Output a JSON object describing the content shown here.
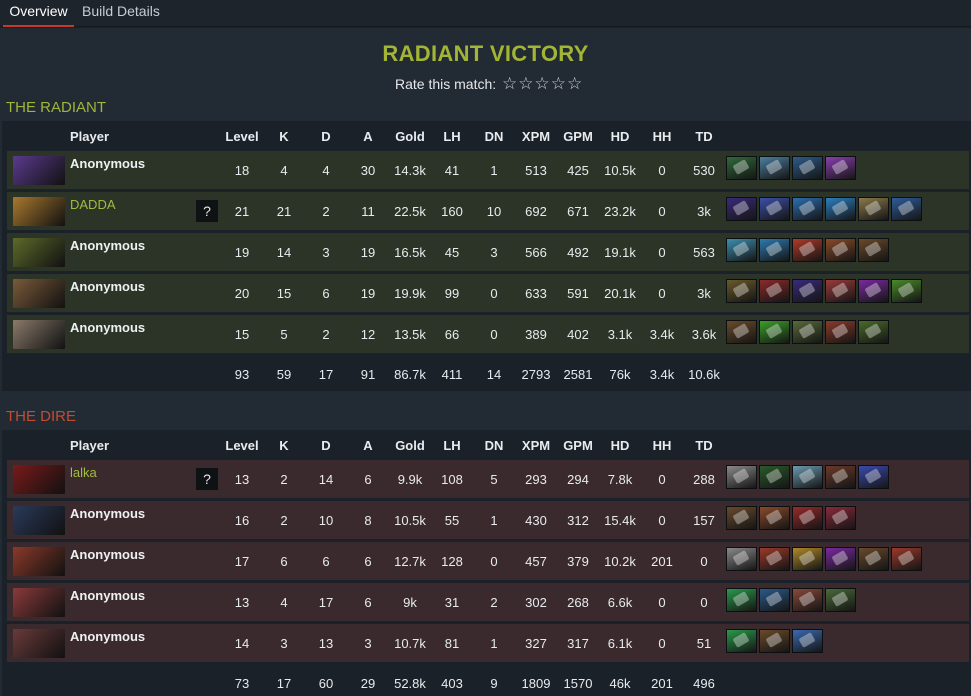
{
  "tabs": [
    "Overview",
    "Build Details"
  ],
  "title": "RADIANT VICTORY",
  "rate_label": "Rate this match:",
  "stars": [
    "☆",
    "☆",
    "☆",
    "☆",
    "☆"
  ],
  "columns": [
    "Player",
    "Level",
    "K",
    "D",
    "A",
    "Gold",
    "LH",
    "DN",
    "XPM",
    "GPM",
    "HD",
    "HH",
    "TD"
  ],
  "radiant": {
    "label": "THE RADIANT",
    "players": [
      {
        "name": "Anonymous",
        "named": false,
        "question": "",
        "stats": [
          "18",
          "4",
          "4",
          "30",
          "14.3k",
          "41",
          "1",
          "513",
          "425",
          "10.5k",
          "0",
          "530"
        ],
        "hero_color": "#5b3a8e",
        "items": [
          "#2f6b3a",
          "#4b7fa0",
          "#2d5c8a",
          "#8a3fb0"
        ]
      },
      {
        "name": "DADDA",
        "named": true,
        "question": "?",
        "stats": [
          "21",
          "21",
          "2",
          "11",
          "22.5k",
          "160",
          "10",
          "692",
          "671",
          "23.2k",
          "0",
          "3k"
        ],
        "hero_color": "#a9792e",
        "items": [
          "#3a2a7a",
          "#3b4fa8",
          "#2c6fb0",
          "#2b7fc0",
          "#8c7a4a",
          "#2f5c9a"
        ]
      },
      {
        "name": "Anonymous",
        "named": false,
        "question": "",
        "stats": [
          "19",
          "14",
          "3",
          "19",
          "16.5k",
          "45",
          "3",
          "566",
          "492",
          "19.1k",
          "0",
          "563"
        ],
        "hero_color": "#5c6a2a",
        "items": [
          "#3d8fb0",
          "#2e7ab0",
          "#b03a2a",
          "#8a4a2a",
          "#6a4a2a"
        ]
      },
      {
        "name": "Anonymous",
        "named": false,
        "question": "",
        "stats": [
          "20",
          "15",
          "6",
          "19",
          "19.9k",
          "99",
          "0",
          "633",
          "591",
          "20.1k",
          "0",
          "3k"
        ],
        "hero_color": "#7a5a3a",
        "items": [
          "#6a5a2a",
          "#8a2a2a",
          "#3a2a7a",
          "#9a3a3a",
          "#7a2aa0",
          "#4a8a2a"
        ]
      },
      {
        "name": "Anonymous",
        "named": false,
        "question": "",
        "stats": [
          "15",
          "5",
          "2",
          "12",
          "13.5k",
          "66",
          "0",
          "389",
          "402",
          "3.1k",
          "3.4k",
          "3.6k"
        ],
        "hero_color": "#8a7a6a",
        "items": [
          "#6a4a2a",
          "#3aa02a",
          "#5a6a3a",
          "#8a3a2a",
          "#4a6a2a"
        ]
      }
    ],
    "totals": [
      "93",
      "59",
      "17",
      "91",
      "86.7k",
      "411",
      "14",
      "2793",
      "2581",
      "76k",
      "3.4k",
      "10.6k"
    ]
  },
  "dire": {
    "label": "THE DIRE",
    "players": [
      {
        "name": "lalka",
        "named": true,
        "question": "?",
        "stats": [
          "13",
          "2",
          "14",
          "6",
          "9.9k",
          "108",
          "5",
          "293",
          "294",
          "7.8k",
          "0",
          "288"
        ],
        "hero_color": "#7a1a1a",
        "items": [
          "#8a8a8a",
          "#2a5a2a",
          "#6a9ab0",
          "#6a3a2a",
          "#3a4ab0"
        ]
      },
      {
        "name": "Anonymous",
        "named": false,
        "question": "",
        "stats": [
          "16",
          "2",
          "10",
          "8",
          "10.5k",
          "55",
          "1",
          "430",
          "312",
          "15.4k",
          "0",
          "157"
        ],
        "hero_color": "#2a3a5a",
        "items": [
          "#6a4a2a",
          "#8a4a2a",
          "#9a2a2a",
          "#8a2a3a"
        ]
      },
      {
        "name": "Anonymous",
        "named": false,
        "question": "",
        "stats": [
          "17",
          "6",
          "6",
          "6",
          "12.7k",
          "128",
          "0",
          "457",
          "379",
          "10.2k",
          "201",
          "0"
        ],
        "hero_color": "#8a3a2a",
        "items": [
          "#8a8a8a",
          "#9a3a2a",
          "#b08a2a",
          "#7a2aa0",
          "#6a4a2a",
          "#9a3a2a"
        ]
      },
      {
        "name": "Anonymous",
        "named": false,
        "question": "",
        "stats": [
          "13",
          "4",
          "17",
          "6",
          "9k",
          "31",
          "2",
          "302",
          "268",
          "6.6k",
          "0",
          "0"
        ],
        "hero_color": "#8a3a3a",
        "items": [
          "#2a9a4a",
          "#2a5a8a",
          "#8a4a3a",
          "#4a6a3a"
        ]
      },
      {
        "name": "Anonymous",
        "named": false,
        "question": "",
        "stats": [
          "14",
          "3",
          "13",
          "3",
          "10.7k",
          "81",
          "1",
          "327",
          "317",
          "6.1k",
          "0",
          "51"
        ],
        "hero_color": "#6a3a3a",
        "items": [
          "#2a9a4a",
          "#6a4a2a",
          "#3a6ab0"
        ]
      }
    ],
    "totals": [
      "73",
      "17",
      "60",
      "29",
      "52.8k",
      "403",
      "9",
      "1809",
      "1570",
      "46k",
      "201",
      "496"
    ]
  }
}
